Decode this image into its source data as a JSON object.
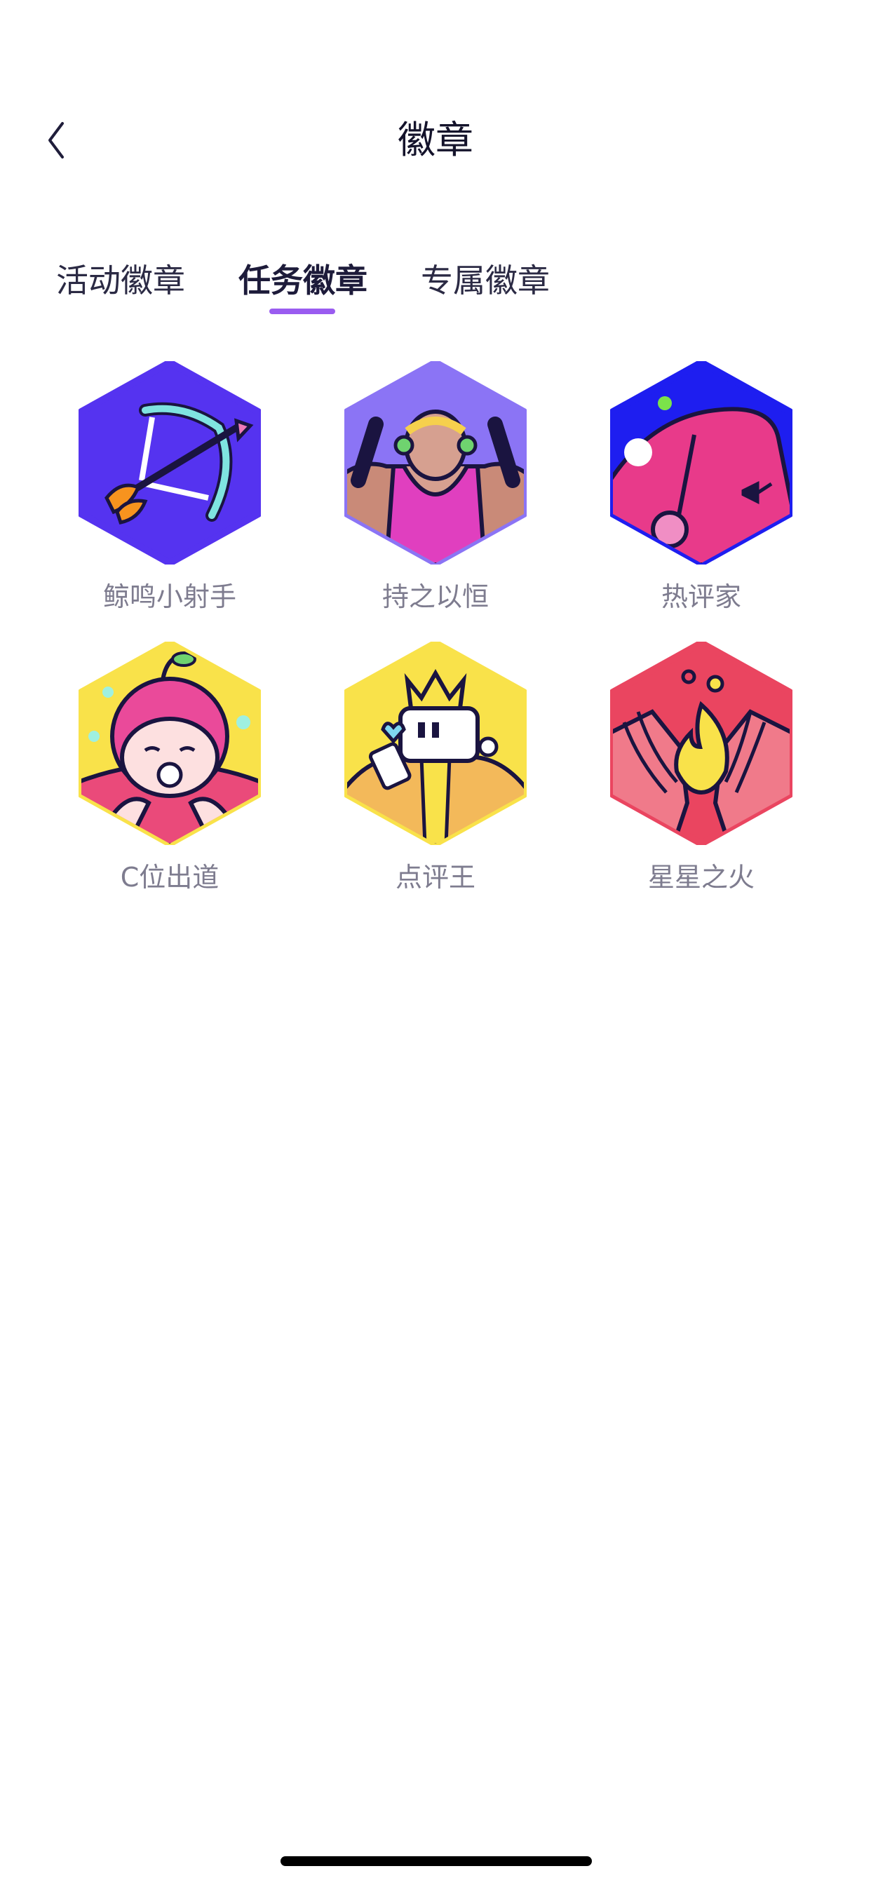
{
  "header": {
    "title": "徽章",
    "back_icon": "chevron-left-icon"
  },
  "tabs": [
    {
      "label": "活动徽章",
      "active": false
    },
    {
      "label": "任务徽章",
      "active": true
    },
    {
      "label": "专属徽章",
      "active": false
    }
  ],
  "accent_color": "#9a5cf0",
  "badges": [
    {
      "label": "鲸鸣小射手",
      "icon": "bow-and-arrow-icon",
      "color": "#5533f0"
    },
    {
      "label": "持之以恒",
      "icon": "weightlifter-icon",
      "color": "#8b74f5"
    },
    {
      "label": "热评家",
      "icon": "pink-blob-icon",
      "color": "#1e1ef0"
    },
    {
      "label": "C位出道",
      "icon": "baby-face-icon",
      "color": "#f9e24a"
    },
    {
      "label": "点评王",
      "icon": "king-chat-icon",
      "color": "#f9e24a"
    },
    {
      "label": "星星之火",
      "icon": "flame-hands-icon",
      "color": "#ea4560"
    }
  ]
}
